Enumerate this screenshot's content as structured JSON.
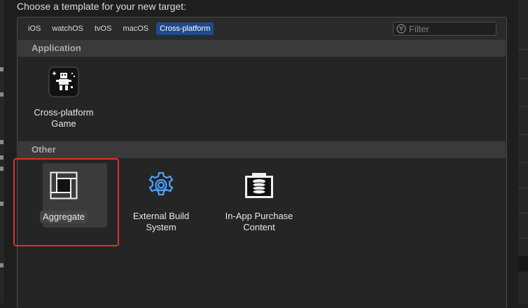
{
  "dialog": {
    "title": "Choose a template for your new target:"
  },
  "tabs": [
    {
      "label": "iOS",
      "selected": false
    },
    {
      "label": "watchOS",
      "selected": false
    },
    {
      "label": "tvOS",
      "selected": false
    },
    {
      "label": "macOS",
      "selected": false
    },
    {
      "label": "Cross-platform",
      "selected": true
    }
  ],
  "filter": {
    "placeholder": "Filter",
    "icon": "filter-icon"
  },
  "sections": {
    "application": {
      "header": "Application",
      "items": [
        {
          "line1": "Cross-platform",
          "line2": "Game",
          "icon": "game-icon"
        }
      ]
    },
    "other": {
      "header": "Other",
      "items": [
        {
          "line1": "Aggregate",
          "icon": "aggregate-icon",
          "selected": true
        },
        {
          "line1": "External Build",
          "line2": "System",
          "icon": "gear-icon"
        },
        {
          "line1": "In-App Purchase",
          "line2": "Content",
          "icon": "in-app-purchase-icon"
        }
      ]
    }
  },
  "colors": {
    "accent": "#1f4a8a",
    "highlight": "#e0302a",
    "gear": "#4aa3ff"
  }
}
